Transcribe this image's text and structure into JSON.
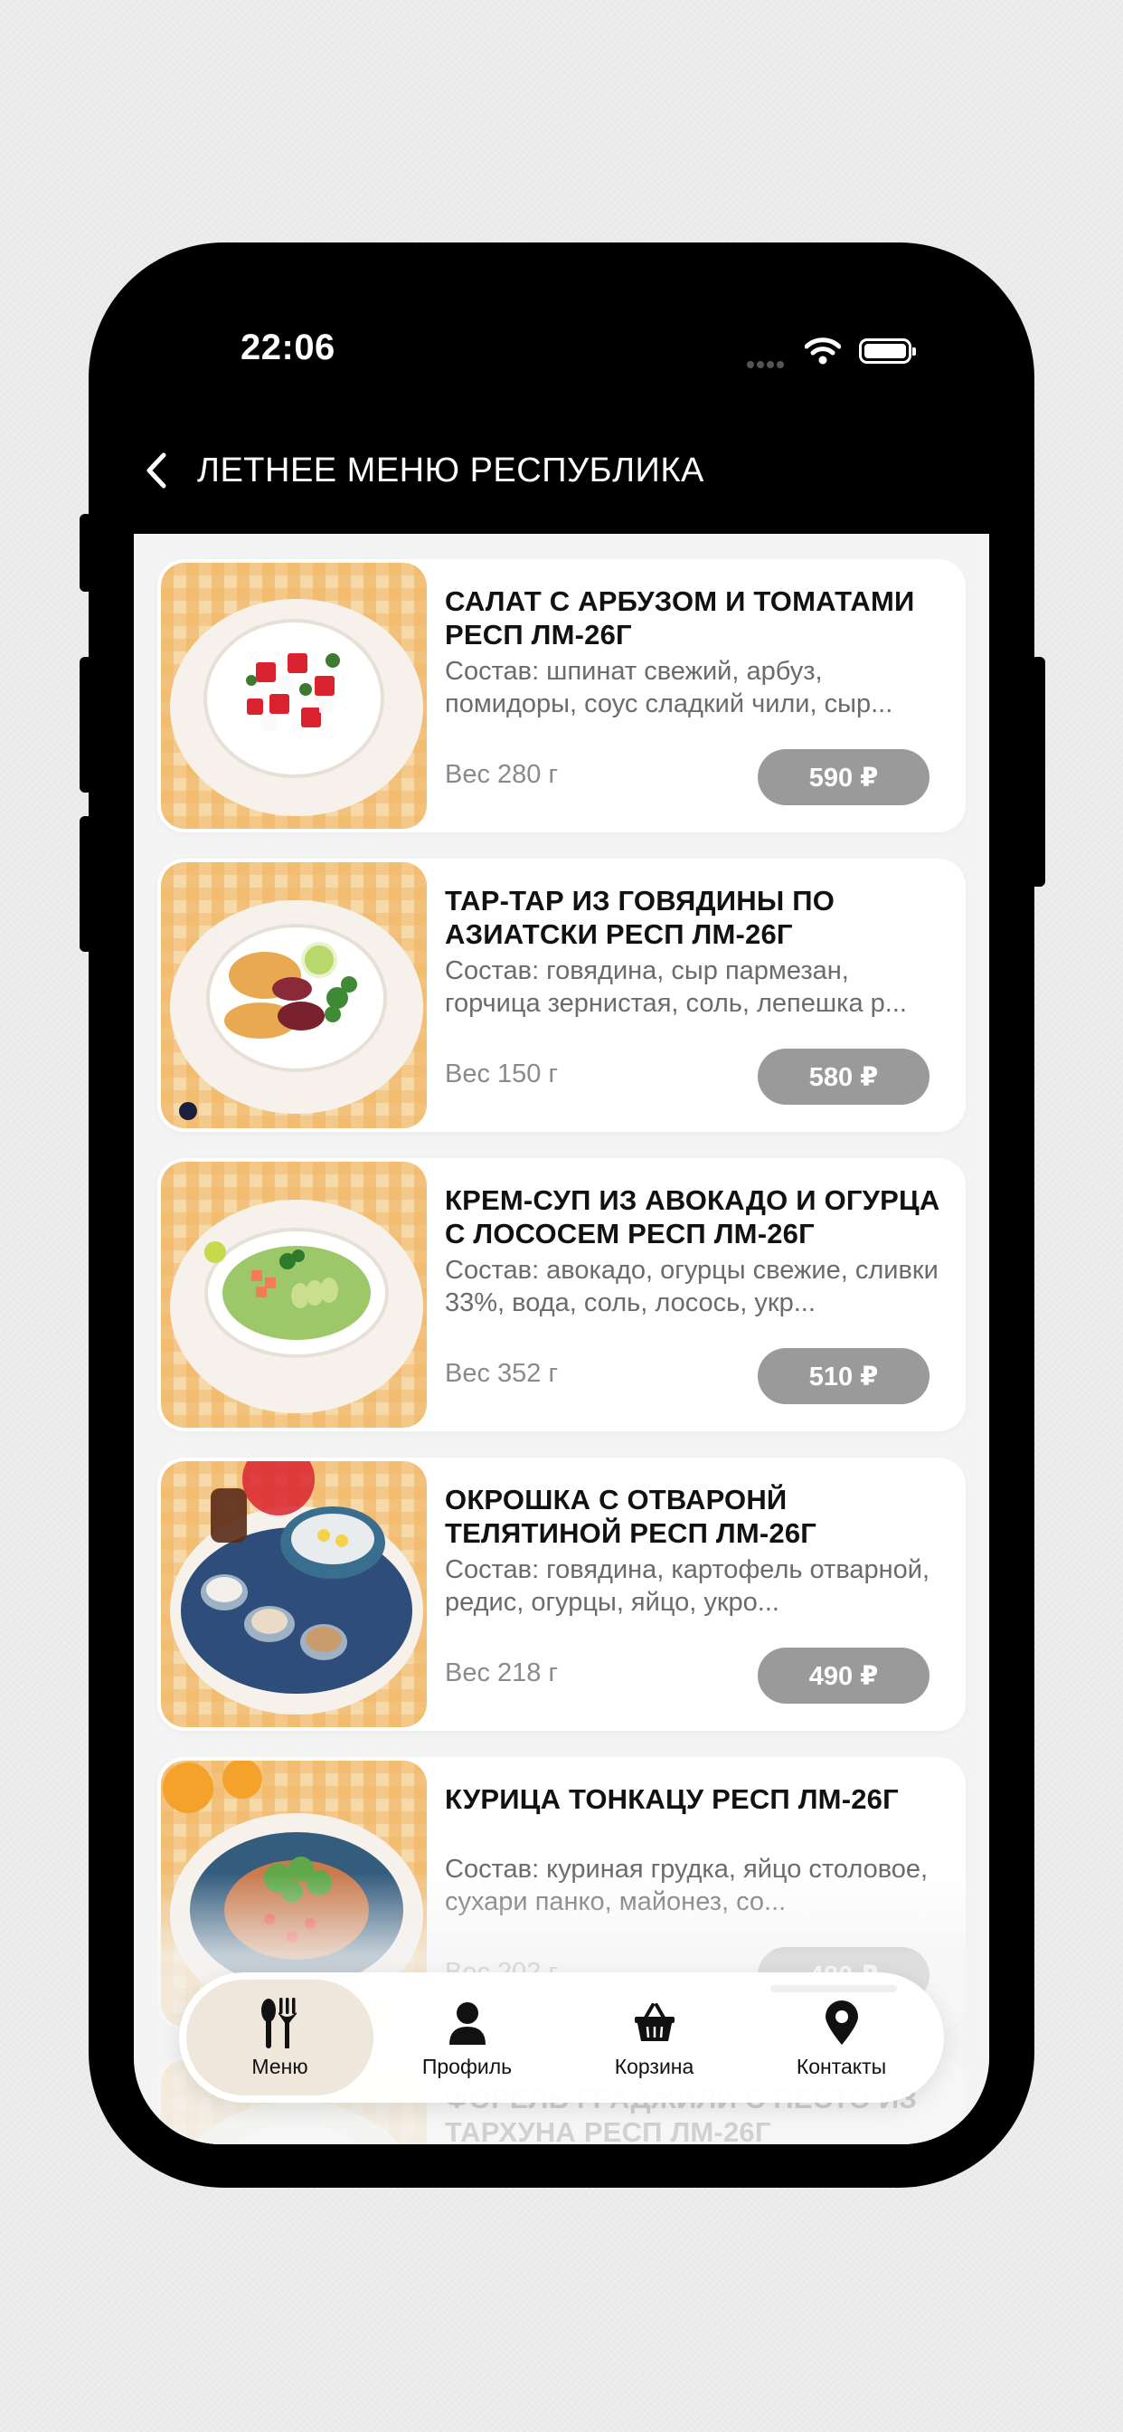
{
  "status_bar": {
    "time": "22:06"
  },
  "header": {
    "title": "ЛЕТНЕЕ МЕНЮ РЕСПУБЛИКА"
  },
  "items": [
    {
      "title": "САЛАТ С АРБУЗОМ И ТОМАТАМИ РЕСП ЛМ-26Г",
      "description": "Состав: шпинат свежий, арбуз, помидоры, соус сладкий чили, сыр...",
      "weight": "Вес 280 г",
      "price": "590 ₽",
      "image": "watermelon-tomato-salad"
    },
    {
      "title": "ТАР-ТАР ИЗ ГОВЯДИНЫ ПО АЗИАТСКИ РЕСП ЛМ-26Г",
      "description": "Состав: говядина, сыр пармезан, горчица зернистая, соль, лепешка р...",
      "weight": "Вес 150 г",
      "price": "580 ₽",
      "image": "beef-tartare"
    },
    {
      "title": "КРЕМ-СУП ИЗ АВОКАДО И ОГУРЦА С ЛОСОСЕМ РЕСП ЛМ-26Г",
      "description": "Состав: авокадо, огурцы свежие, сливки 33%, вода, соль, лосось, укр...",
      "weight": "Вес 352 г",
      "price": "510 ₽",
      "image": "avocado-cream-soup"
    },
    {
      "title": "ОКРОШКА С ОТВАРОНЙ ТЕЛЯТИНОЙ РЕСП ЛМ-26Г",
      "description": "Состав: говядина, картофель отварной, редис, огурцы, яйцо, укро...",
      "weight": "Вес 218 г",
      "price": "490 ₽",
      "image": "okroshka"
    },
    {
      "title": "КУРИЦА ТОНКАЦУ РЕСП ЛМ-26Г",
      "description": "Состав: куриная грудка, яйцо столовое, сухари панко, майонез, со...",
      "weight": "Вес 202 г",
      "price": "480 ₽",
      "image": "chicken-tonkatsu"
    },
    {
      "title": "ФОРЕЛЬ ГРАДЖИЛИ С ПЕСТО ИЗ ТАРХУНА РЕСП ЛМ-26Г",
      "description": "",
      "weight": "",
      "price": "",
      "image": "trout"
    }
  ],
  "tabbar": {
    "tabs": [
      {
        "label": "Меню",
        "icon": "fork-knife-icon",
        "active": true
      },
      {
        "label": "Профиль",
        "icon": "person-icon",
        "active": false
      },
      {
        "label": "Корзина",
        "icon": "basket-icon",
        "active": false
      },
      {
        "label": "Контакты",
        "icon": "location-pin-icon",
        "active": false
      }
    ]
  }
}
